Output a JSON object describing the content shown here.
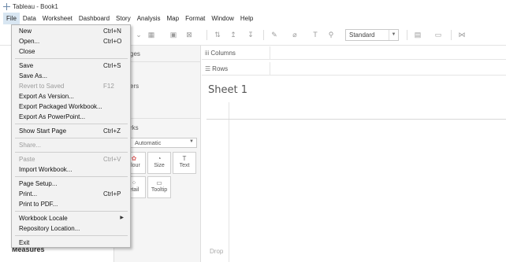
{
  "window": {
    "title": "Tableau - Book1"
  },
  "menubar": {
    "items": [
      "File",
      "Data",
      "Worksheet",
      "Dashboard",
      "Story",
      "Analysis",
      "Map",
      "Format",
      "Window",
      "Help"
    ]
  },
  "toolbar": {
    "fit_select": "Standard"
  },
  "file_menu": {
    "new": {
      "label": "New",
      "shortcut": "Ctrl+N"
    },
    "open": {
      "label": "Open...",
      "shortcut": "Ctrl+O"
    },
    "close": {
      "label": "Close"
    },
    "save": {
      "label": "Save",
      "shortcut": "Ctrl+S"
    },
    "save_as": {
      "label": "Save As..."
    },
    "revert": {
      "label": "Revert to Saved",
      "shortcut": "F12"
    },
    "export_version": {
      "label": "Export As Version..."
    },
    "export_packaged": {
      "label": "Export Packaged Workbook..."
    },
    "export_ppt": {
      "label": "Export As PowerPoint..."
    },
    "start_page": {
      "label": "Show Start Page",
      "shortcut": "Ctrl+Z"
    },
    "share": {
      "label": "Share..."
    },
    "paste": {
      "label": "Paste",
      "shortcut": "Ctrl+V"
    },
    "import": {
      "label": "Import Workbook..."
    },
    "page_setup": {
      "label": "Page Setup..."
    },
    "print": {
      "label": "Print...",
      "shortcut": "Ctrl+P"
    },
    "print_pdf": {
      "label": "Print to PDF..."
    },
    "locale": {
      "label": "Workbook Locale"
    },
    "repo": {
      "label": "Repository Location..."
    },
    "exit": {
      "label": "Exit"
    }
  },
  "cards": {
    "pages_partial": "ges",
    "filters_partial": "ers",
    "marks_partial": "rks",
    "marks_type": "Automatic",
    "buttons": {
      "color": "olour",
      "size": "Size",
      "text": "Text",
      "detail": "etail",
      "tooltip": "Tooltip"
    }
  },
  "shelves": {
    "columns": "Columns",
    "rows": "Rows"
  },
  "sheet": {
    "title": "Sheet 1",
    "drop_hint": "Drop"
  },
  "data_pane": {
    "measures": "Measures"
  }
}
